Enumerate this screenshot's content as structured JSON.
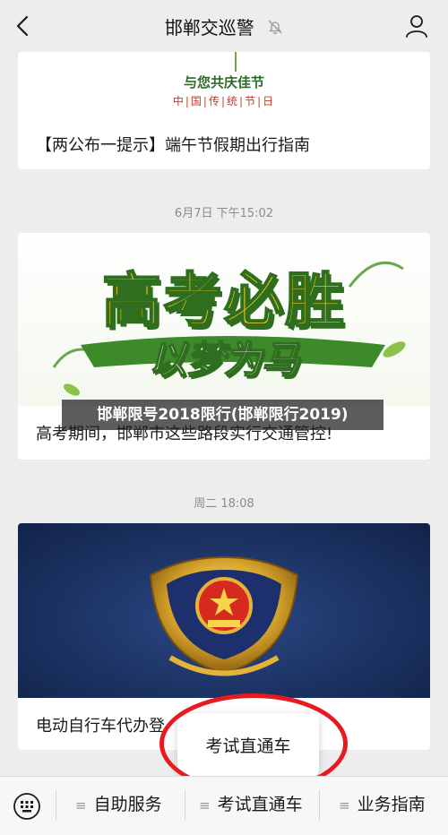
{
  "header": {
    "title": "邯郸交巡警",
    "icons": [
      "back-arrow-icon",
      "muted-bell-icon",
      "profile-icon"
    ]
  },
  "card1": {
    "banner_line1": "与您共庆佳节",
    "banner_line2": "中|国|传|统|节|日",
    "title": "【两公布一提示】端午节假期出行指南"
  },
  "timestamp1": "6月7日 下午15:02",
  "card2": {
    "banner_line1": "高考必胜",
    "banner_line2": "以梦为马",
    "title": "高考期间，邯郸市这些路段实行交通管控!",
    "overlay": "邯郸限号2018限行(邯郸限行2019)"
  },
  "timestamp2": "周二 18:08",
  "card3": {
    "title": "电动自行车代办登",
    "banner_icon": "police-emblem-icon"
  },
  "popup": {
    "label": "考试直通车"
  },
  "bottom_menu": {
    "keyboard_icon": "keyboard-icon",
    "items": [
      {
        "label": "自助服务"
      },
      {
        "label": "考试直通车"
      },
      {
        "label": "业务指南"
      }
    ]
  },
  "colors": {
    "highlight": "#e8191f",
    "accent_green": "#4a8a2b"
  }
}
